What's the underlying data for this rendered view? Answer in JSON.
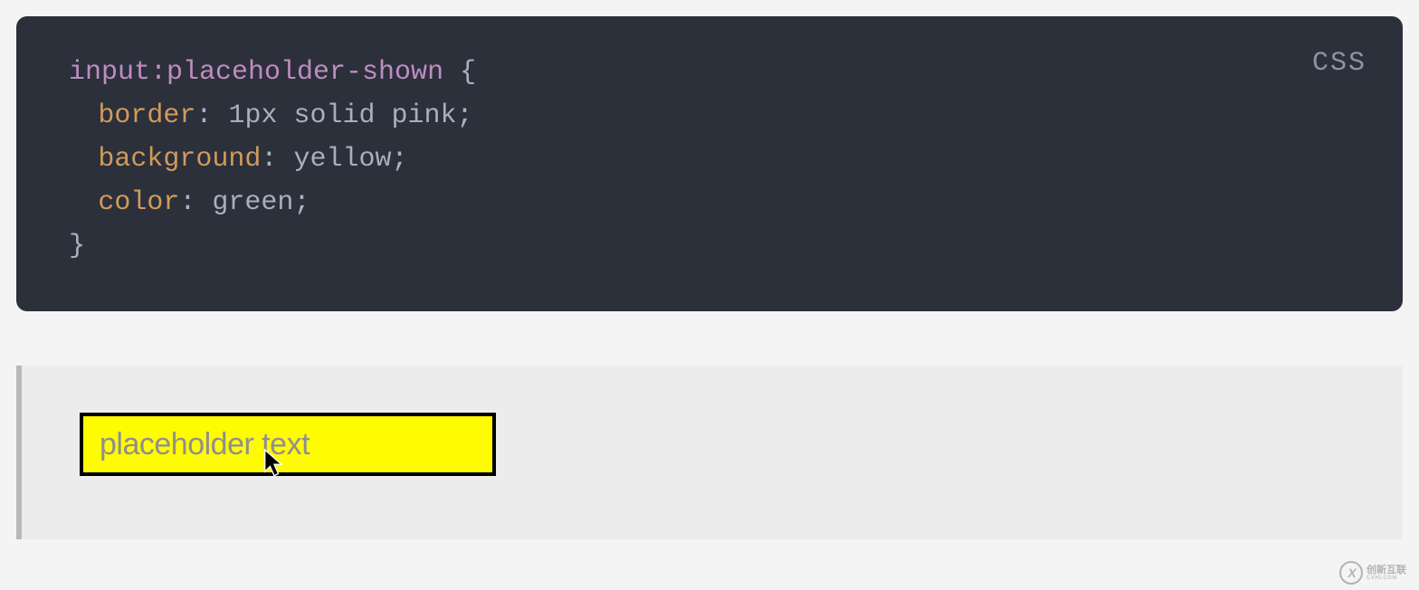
{
  "code": {
    "language": "CSS",
    "selector": "input:placeholder-shown",
    "open_brace": " {",
    "lines": [
      {
        "prop": "border",
        "value": "1px solid pink"
      },
      {
        "prop": "background",
        "value": "yellow"
      },
      {
        "prop": "color",
        "value": "green"
      }
    ],
    "close_brace": "}",
    "colon": ": ",
    "semicolon": ";"
  },
  "demo": {
    "placeholder": "placeholder text"
  },
  "watermark": {
    "brand": "创新互联",
    "sub": "CXHLCOM"
  }
}
